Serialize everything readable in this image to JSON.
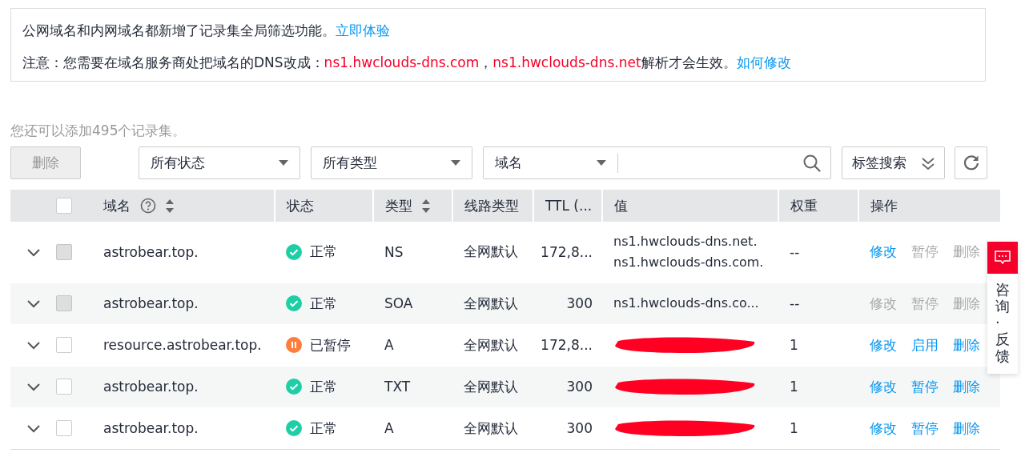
{
  "notice": {
    "line1": "公网域名和内网域名都新增了记录集全局筛选功能。",
    "line1_link": "立即体验",
    "line2_prefix": "注意：您需要在域名服务商处把域名的DNS改成：",
    "ns1": "ns1.hwclouds-dns.com",
    "separator": "，",
    "ns2": "ns1.hwclouds-dns.net",
    "line2_suffix": "解析才会生效。",
    "line2_link": "如何修改"
  },
  "quota_text": "您还可以添加495个记录集。",
  "toolbar": {
    "delete_button": {
      "label": "删除",
      "disabled": true
    },
    "status_filter": "所有状态",
    "type_filter": "所有类型",
    "search_field_select": "域名",
    "tag_search": "标签搜索"
  },
  "table": {
    "select_all": {
      "checked": false
    },
    "columns": [
      {
        "label": "域名",
        "help": true,
        "sortable": true
      },
      {
        "label": "状态",
        "help": false,
        "sortable": false
      },
      {
        "label": "类型",
        "help": false,
        "sortable": true
      },
      {
        "label": "线路类型",
        "help": false,
        "sortable": false
      },
      {
        "label": "TTL (...",
        "help": false,
        "sortable": false
      },
      {
        "label": "值",
        "help": false,
        "sortable": false
      },
      {
        "label": "权重",
        "help": false,
        "sortable": false
      },
      {
        "label": "操作",
        "help": false,
        "sortable": false
      }
    ],
    "rows": [
      {
        "checked": false,
        "disabled": true,
        "domain": "astrobear.top.",
        "status": {
          "kind": "normal",
          "label": "正常"
        },
        "type": "NS",
        "line": "全网默认",
        "ttl": "172,8...",
        "value": {
          "kind": "text",
          "lines": [
            "ns1.hwclouds-dns.net.",
            "ns1.hwclouds-dns.com."
          ]
        },
        "weight": "--",
        "actions": [
          {
            "label": "修改",
            "disabled": false
          },
          {
            "label": "暂停",
            "disabled": true
          },
          {
            "label": "删除",
            "disabled": true
          }
        ]
      },
      {
        "checked": false,
        "disabled": true,
        "domain": "astrobear.top.",
        "status": {
          "kind": "normal",
          "label": "正常"
        },
        "type": "SOA",
        "line": "全网默认",
        "ttl": "300",
        "value": {
          "kind": "text",
          "lines": [
            "ns1.hwclouds-dns.co..."
          ]
        },
        "weight": "--",
        "actions": [
          {
            "label": "修改",
            "disabled": true
          },
          {
            "label": "暂停",
            "disabled": true
          },
          {
            "label": "删除",
            "disabled": true
          }
        ]
      },
      {
        "checked": false,
        "disabled": false,
        "domain": "resource.astrobear.top.",
        "status": {
          "kind": "paused",
          "label": "已暂停"
        },
        "type": "A",
        "line": "全网默认",
        "ttl": "172,8...",
        "value": {
          "kind": "redacted"
        },
        "weight": "1",
        "actions": [
          {
            "label": "修改",
            "disabled": false
          },
          {
            "label": "启用",
            "disabled": false
          },
          {
            "label": "删除",
            "disabled": false
          }
        ]
      },
      {
        "checked": false,
        "disabled": false,
        "domain": "astrobear.top.",
        "status": {
          "kind": "normal",
          "label": "正常"
        },
        "type": "TXT",
        "line": "全网默认",
        "ttl": "300",
        "value": {
          "kind": "redacted"
        },
        "weight": "1",
        "actions": [
          {
            "label": "修改",
            "disabled": false
          },
          {
            "label": "暂停",
            "disabled": false
          },
          {
            "label": "删除",
            "disabled": false
          }
        ]
      },
      {
        "checked": false,
        "disabled": false,
        "domain": "astrobear.top.",
        "status": {
          "kind": "normal",
          "label": "正常"
        },
        "type": "A",
        "line": "全网默认",
        "ttl": "300",
        "value": {
          "kind": "redacted"
        },
        "weight": "1",
        "actions": [
          {
            "label": "修改",
            "disabled": false
          },
          {
            "label": "暂停",
            "disabled": false
          },
          {
            "label": "删除",
            "disabled": false
          }
        ]
      }
    ]
  },
  "feedback": {
    "label": "咨询·反馈"
  }
}
